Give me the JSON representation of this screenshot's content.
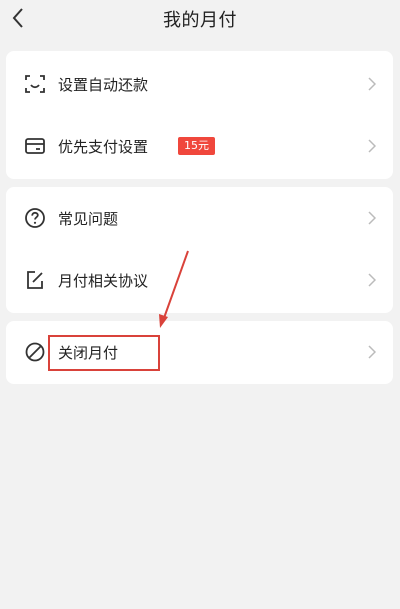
{
  "header": {
    "title": "我的月付"
  },
  "card1": {
    "items": [
      {
        "label": "设置自动还款",
        "icon": "scan-face-icon"
      },
      {
        "label": "优先支付设置",
        "icon": "card-icon",
        "badge": "15元"
      }
    ]
  },
  "card2": {
    "items": [
      {
        "label": "常见问题",
        "icon": "question-circle-icon"
      },
      {
        "label": "月付相关协议",
        "icon": "edit-document-icon"
      }
    ]
  },
  "card3": {
    "items": [
      {
        "label": "关闭月付",
        "icon": "ban-icon"
      }
    ]
  },
  "colors": {
    "accent": "#f0473c",
    "annotation": "#d9423a",
    "background": "#f2f2f2"
  }
}
